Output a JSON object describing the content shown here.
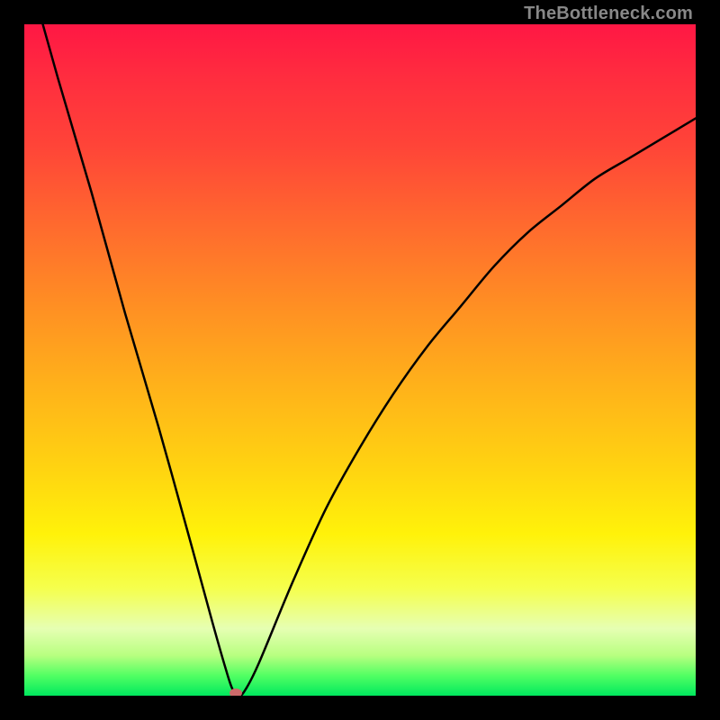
{
  "watermark": "TheBottleneck.com",
  "chart_data": {
    "type": "line",
    "title": "",
    "xlabel": "",
    "ylabel": "",
    "xlim": [
      0,
      100
    ],
    "ylim": [
      0,
      100
    ],
    "grid": false,
    "legend": false,
    "gradient_colors": [
      "#ff1744",
      "#ff8f23",
      "#fff20a",
      "#00e85e"
    ],
    "series": [
      {
        "name": "curve",
        "color": "#000000",
        "x": [
          0,
          5,
          10,
          15,
          20,
          25,
          28,
          30,
          31,
          32,
          33,
          35,
          40,
          45,
          50,
          55,
          60,
          65,
          70,
          75,
          80,
          85,
          90,
          95,
          100
        ],
        "y": [
          110,
          92,
          75,
          57,
          40,
          22,
          11,
          4,
          1,
          0,
          1,
          5,
          17,
          28,
          37,
          45,
          52,
          58,
          64,
          69,
          73,
          77,
          80,
          83,
          86
        ]
      }
    ],
    "marker": {
      "x": 31.5,
      "y": 0,
      "color": "#cc6a6a"
    }
  }
}
